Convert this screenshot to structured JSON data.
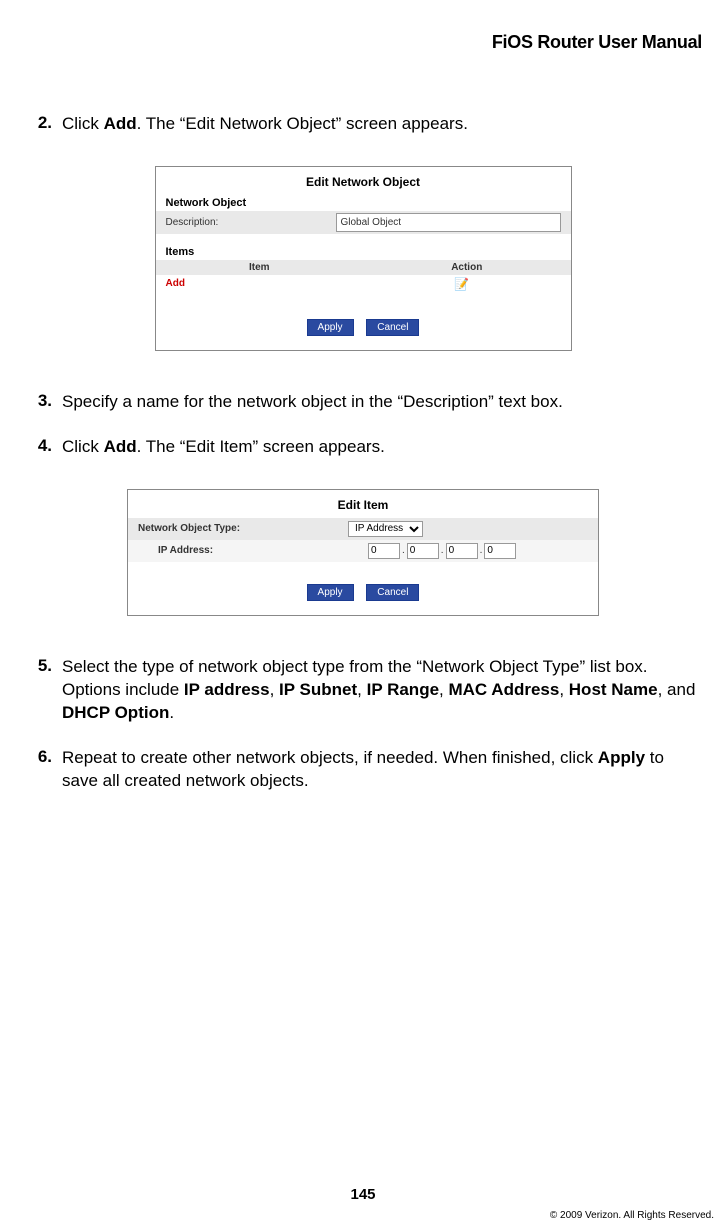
{
  "header": {
    "title": "FiOS Router User Manual"
  },
  "steps": {
    "s2": {
      "num": "2.",
      "pre": "Click ",
      "bold": "Add",
      "post": ". The “Edit Network Object” screen appears."
    },
    "s3": {
      "num": "3.",
      "text": "Specify a name for the network object in the “Description” text box."
    },
    "s4": {
      "num": "4.",
      "pre": "Click ",
      "bold": "Add",
      "post": ". The “Edit Item” screen appears."
    },
    "s5": {
      "num": "5.",
      "pre": "Select the type of network object type from the “Network Object Type” list box. Options include ",
      "opts": [
        "IP address",
        "IP Subnet",
        "IP Range",
        "MAC Address",
        "Host Name",
        "DHCP Option"
      ],
      "sep": ", ",
      "and": ", and ",
      "post": "."
    },
    "s6": {
      "num": "6.",
      "pre": "Repeat to create other network objects, if needed. When finished, click ",
      "bold": "Apply",
      "post": " to save all created network objects."
    }
  },
  "eno": {
    "title": "Edit Network Object",
    "section_network_object": "Network Object",
    "desc_label": "Description:",
    "desc_value": "Global Object",
    "section_items": "Items",
    "col_item": "Item",
    "col_action": "Action",
    "add_link": "Add",
    "apply": "Apply",
    "cancel": "Cancel"
  },
  "ei": {
    "title": "Edit Item",
    "type_label": "Network Object Type:",
    "type_value": "IP Address",
    "ip_label": "IP Address:",
    "ip": [
      "0",
      "0",
      "0",
      "0"
    ],
    "apply": "Apply",
    "cancel": "Cancel"
  },
  "footer": {
    "page": "145",
    "copyright": "© 2009 Verizon. All Rights Reserved."
  }
}
